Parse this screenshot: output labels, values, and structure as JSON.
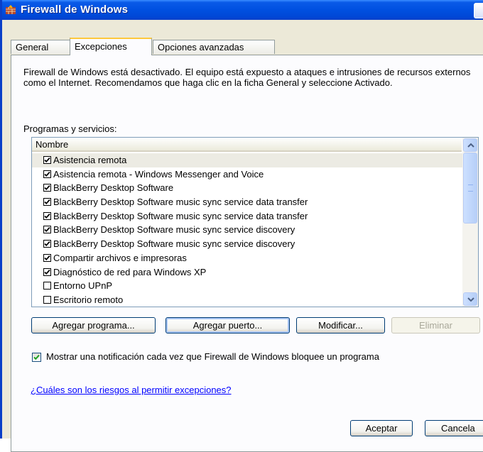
{
  "window": {
    "title": "Firewall de Windows"
  },
  "tabs": [
    {
      "label": "General",
      "active": false
    },
    {
      "label": "Excepciones",
      "active": true
    },
    {
      "label": "Opciones avanzadas",
      "active": false
    }
  ],
  "description": "Firewall de Windows está desactivado. El equipo está expuesto a ataques e intrusiones de recursos externos como el Internet. Recomendamos que haga clic en la ficha General y seleccione Activado.",
  "programs": {
    "label": "Programas y servicios:",
    "column_header": "Nombre",
    "items": [
      {
        "label": "Asistencia remota",
        "checked": true,
        "selected": true
      },
      {
        "label": "Asistencia remota  - Windows Messenger and Voice",
        "checked": true,
        "selected": false
      },
      {
        "label": "BlackBerry Desktop Software",
        "checked": true,
        "selected": false
      },
      {
        "label": "BlackBerry Desktop Software music sync service data transfer",
        "checked": true,
        "selected": false
      },
      {
        "label": "BlackBerry Desktop Software music sync service data transfer",
        "checked": true,
        "selected": false
      },
      {
        "label": "BlackBerry Desktop Software music sync service discovery",
        "checked": true,
        "selected": false
      },
      {
        "label": "BlackBerry Desktop Software music sync service discovery",
        "checked": true,
        "selected": false
      },
      {
        "label": "Compartir archivos e impresoras",
        "checked": true,
        "selected": false
      },
      {
        "label": "Diagnóstico de red para Windows XP",
        "checked": true,
        "selected": false
      },
      {
        "label": "Entorno UPnP",
        "checked": false,
        "selected": false
      },
      {
        "label": "Escritorio remoto",
        "checked": false,
        "selected": false
      }
    ]
  },
  "buttons": {
    "add_program": "Agregar programa...",
    "add_port": "Agregar puerto...",
    "modify": "Modificar...",
    "delete": "Eliminar",
    "ok": "Aceptar",
    "cancel": "Cancela"
  },
  "notify": {
    "label": "Mostrar una notificación cada vez que Firewall de Windows bloquee un programa",
    "checked": true
  },
  "link": {
    "label": "¿Cuáles son los riesgos al permitir excepciones?"
  },
  "colors": {
    "titlebar": "#0050e0",
    "tab_highlight": "#ffc83c",
    "link": "#0000ff",
    "check_green": "#21a121"
  },
  "icons": {
    "title": "firewall-icon",
    "check": "checkmark-icon",
    "scroll_up": "chevron-up-icon",
    "scroll_down": "chevron-down-icon"
  }
}
